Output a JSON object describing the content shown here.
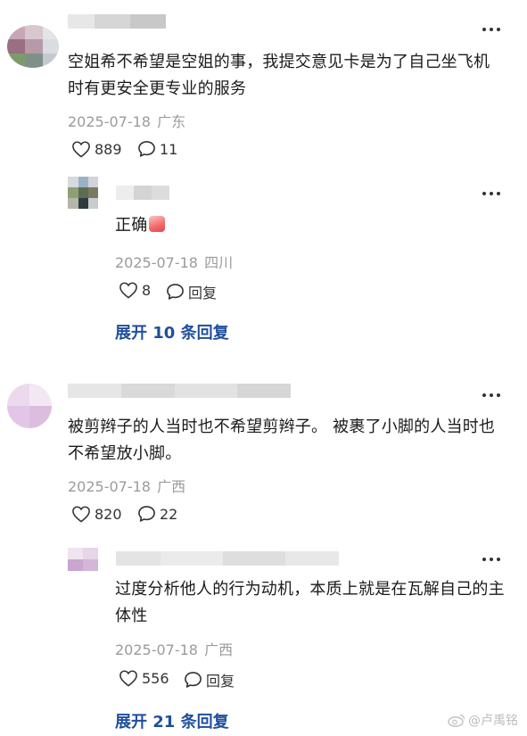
{
  "comments": [
    {
      "text": "空姐希不希望是空姐的事，我提交意见卡是为了自己坐飞机时有更安全更专业的服务",
      "date": "2025-07-18",
      "location": "广东",
      "likes": "889",
      "replies": "11",
      "reply": {
        "text": "正确",
        "date": "2025-07-18",
        "location": "四川",
        "likes": "8",
        "reply_label": "回复"
      },
      "expand_label": "展开 10 条回复"
    },
    {
      "text": "被剪辫子的人当时也不希望剪辫子。 被裹了小脚的人当时也不希望放小脚。",
      "date": "2025-07-18",
      "location": "广西",
      "likes": "820",
      "replies": "22",
      "reply": {
        "text": "过度分析他人的行为动机，本质上就是在瓦解自己的主体性",
        "date": "2025-07-18",
        "location": "广西",
        "likes": "556",
        "reply_label": "回复"
      },
      "expand_label": "展开 21 条回复"
    }
  ],
  "watermark": "@卢禹铭",
  "icons": {
    "like": "heart-outline-icon",
    "comment": "speech-bubble-icon",
    "more": "more-dots-icon",
    "emoji": "thumbs-up-emoji-icon",
    "watermark": "weibo-logo-icon"
  },
  "colors": {
    "link": "#1f4f9c",
    "meta": "#9b9b9b",
    "text": "#1a1a1a"
  }
}
